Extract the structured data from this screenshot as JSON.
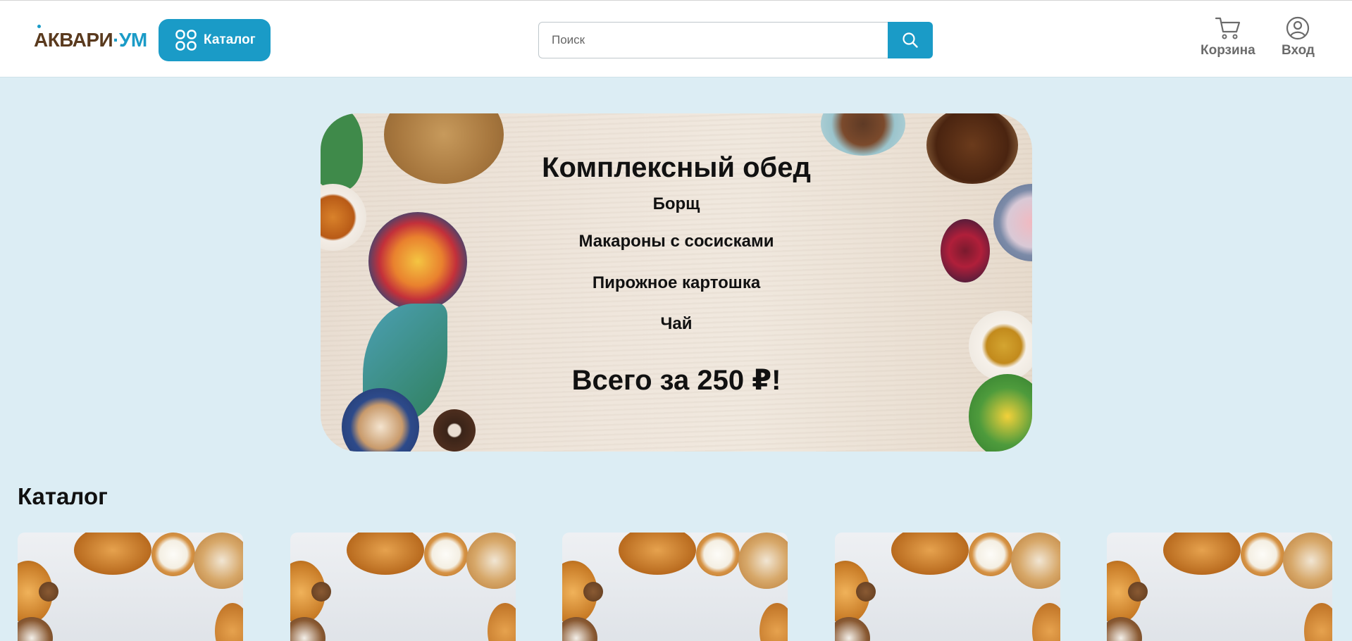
{
  "header": {
    "logo_part1": "АКВАРИ",
    "logo_part2": "·УМ",
    "catalog_button": "Каталог",
    "search_placeholder": "Поиск",
    "cart_label": "Корзина",
    "login_label": "Вход"
  },
  "banner": {
    "title": "Комплексный обед",
    "items": [
      "Борщ",
      "Макароны с сосисками",
      "Пирожное картошка",
      "Чай"
    ],
    "price_text": "Всего за 250 ₽!"
  },
  "catalog": {
    "title": "Каталог",
    "cards": [
      {
        "image": "pastries-photo"
      },
      {
        "image": "pastries-photo"
      },
      {
        "image": "pastries-photo"
      },
      {
        "image": "pastries-photo"
      },
      {
        "image": "pastries-photo"
      }
    ]
  },
  "colors": {
    "accent": "#1a9bc7",
    "background": "#dcedf4",
    "logo_brown": "#5a3a1e"
  }
}
